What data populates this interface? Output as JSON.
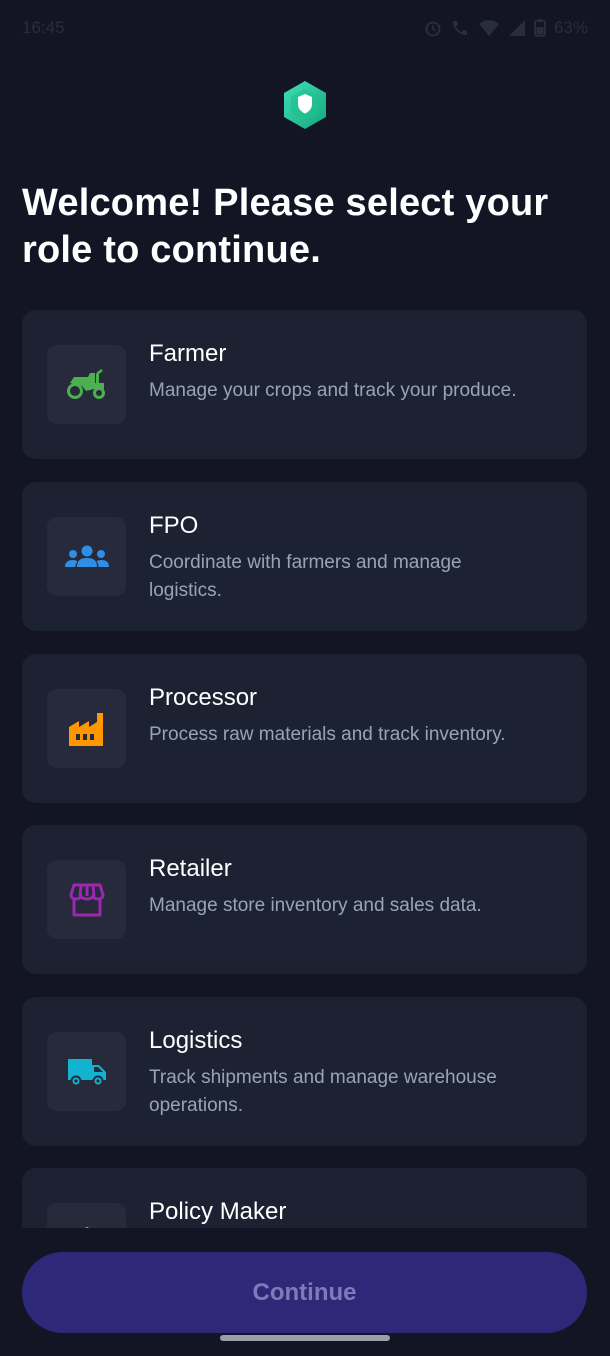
{
  "status_bar": {
    "time": "16:45",
    "battery": "63%",
    "icons": [
      "alarm-icon",
      "call-icon",
      "wifi-icon",
      "signal-icon",
      "battery-icon"
    ]
  },
  "header": {
    "logo_icon": "shield-logo-icon",
    "title": "Welcome! Please select your role to continue."
  },
  "roles": [
    {
      "title": "Farmer",
      "description": "Manage your crops and track your produce.",
      "icon": "tractor-icon",
      "color": "#4caf50"
    },
    {
      "title": "FPO",
      "description": "Coordinate with farmers and manage logistics.",
      "icon": "group-icon",
      "color": "#2f8fe6"
    },
    {
      "title": "Processor",
      "description": "Process raw materials and track inventory.",
      "icon": "factory-icon",
      "color": "#ff9800"
    },
    {
      "title": "Retailer",
      "description": "Manage store inventory and sales data.",
      "icon": "store-icon",
      "color": "#9c27b0"
    },
    {
      "title": "Logistics",
      "description": "Track shipments and manage warehouse operations.",
      "icon": "truck-icon",
      "color": "#12b3d0"
    },
    {
      "title": "Policy Maker",
      "description": "",
      "icon": "policy-icon",
      "color": "#f0c419"
    }
  ],
  "actions": {
    "continue_label": "Continue"
  },
  "colors": {
    "background": "#131524",
    "card": "#1d2233",
    "button": "#2e2878",
    "button_text": "#7f7ab8"
  }
}
